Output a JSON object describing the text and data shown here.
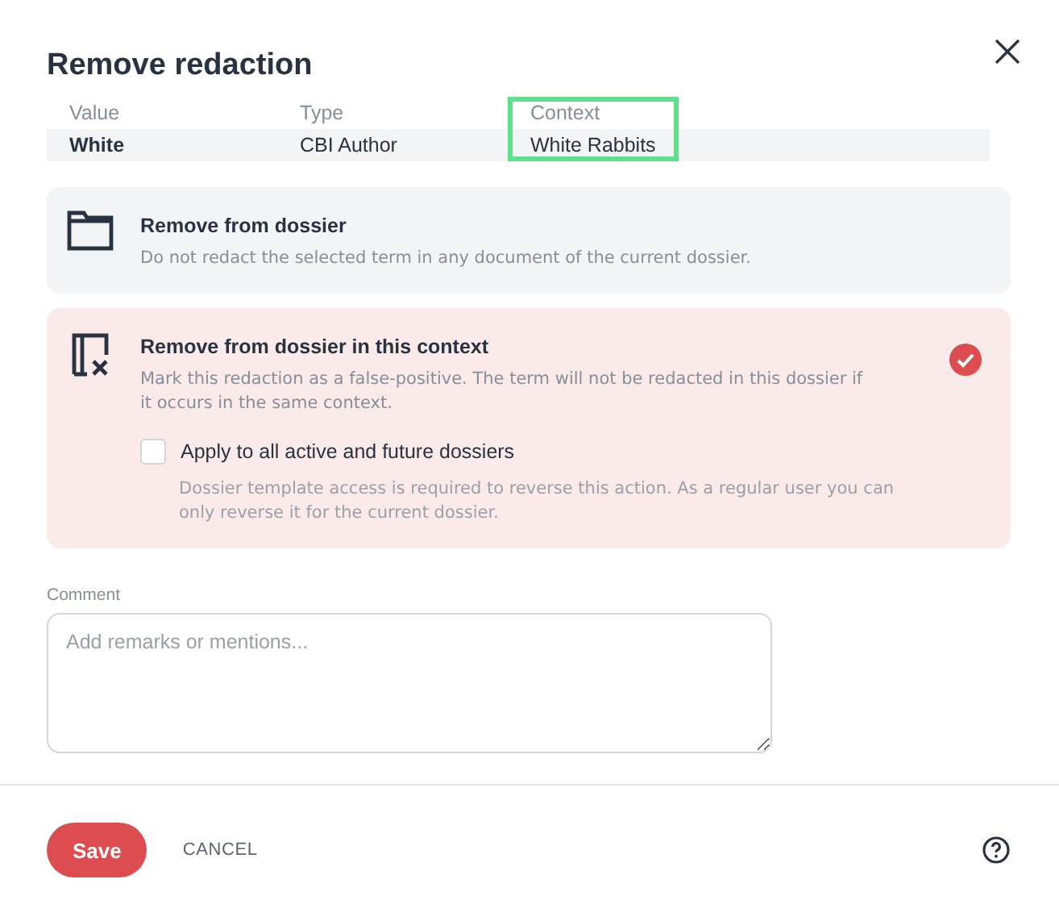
{
  "dialog": {
    "title": "Remove redaction"
  },
  "table": {
    "columns": [
      {
        "label": "Value",
        "highlighted": false
      },
      {
        "label": "Type",
        "highlighted": false
      },
      {
        "label": "Context",
        "highlighted": true
      }
    ],
    "rows": [
      {
        "cells": [
          "White",
          "CBI Author",
          "White Rabbits"
        ]
      }
    ]
  },
  "options": [
    {
      "title": "Remove from dossier",
      "description": "Do not redact the selected term in any document of the current dossier.",
      "selected": false
    },
    {
      "title": "Remove from dossier in this context",
      "description": "Mark this redaction as a false-positive. The term will not be redacted in this dossier if it occurs in the same context.",
      "selected": true,
      "checkbox": {
        "label": "Apply to all active and future dossiers",
        "checked": false,
        "hint": "Dossier template access is required to reverse this action. As a regular user you can only reverse it for the current dossier."
      }
    }
  ],
  "comment": {
    "label": "Comment",
    "placeholder": "Add remarks or mentions..."
  },
  "footer": {
    "save": "Save",
    "cancel": "CANCEL"
  }
}
